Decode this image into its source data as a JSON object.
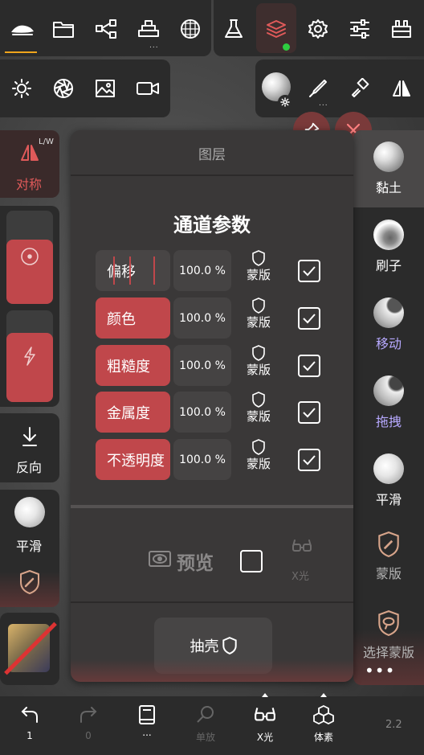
{
  "top_toolbar": {
    "badge_dots": "...",
    "layers_dot_color": "#2ecc40"
  },
  "floating": {
    "pin_icon": "pin-icon",
    "close_icon": "close-icon"
  },
  "left_sidebar": {
    "symmetry_badge": "L/W",
    "symmetry_label": "对称",
    "reverse_label": "反向",
    "smooth_label": "平滑"
  },
  "right_sidebar": {
    "items": [
      {
        "label": "黏土"
      },
      {
        "label": "刷子"
      },
      {
        "label": "移动"
      },
      {
        "label": "拖拽"
      },
      {
        "label": "平滑"
      },
      {
        "label": "蒙版"
      },
      {
        "label": "选择蒙版"
      }
    ]
  },
  "layer_panel": {
    "title": "图层",
    "section_title": "通道参数",
    "rows": [
      {
        "label": "偏移",
        "value": "100.0 %",
        "mask": "蒙版",
        "checked": true
      },
      {
        "label": "颜色",
        "value": "100.0 %",
        "mask": "蒙版",
        "checked": true
      },
      {
        "label": "粗糙度",
        "value": "100.0 %",
        "mask": "蒙版",
        "checked": true
      },
      {
        "label": "金属度",
        "value": "100.0 %",
        "mask": "蒙版",
        "checked": true
      },
      {
        "label": "不透明度",
        "value": "100.0 %",
        "mask": "蒙版",
        "checked": true
      }
    ],
    "preview_label": "预览",
    "xray_label": "X光",
    "extract_label": "抽壳",
    "accent_color": "#c0474b"
  },
  "bottom_bar": {
    "undo_count": "1",
    "redo_count": "0",
    "book_dots": "...",
    "single_label": "单放",
    "xray_label": "X光",
    "voxel_label": "体素",
    "version": "2.2"
  }
}
